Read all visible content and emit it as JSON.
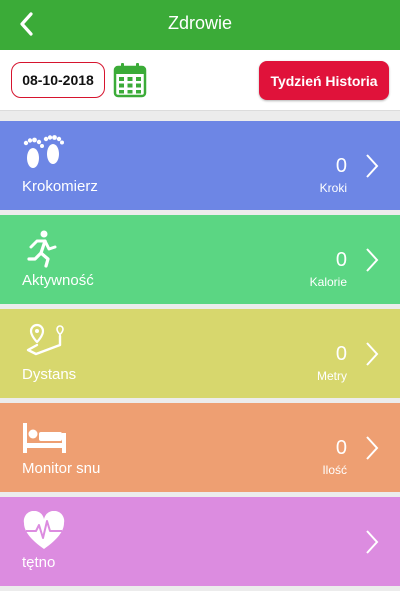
{
  "header": {
    "title": "Zdrowie"
  },
  "toolbar": {
    "date": "08-10-2018",
    "history_button": "Tydzień Historia"
  },
  "cards": [
    {
      "label": "Krokomierz",
      "value": "0",
      "unit": "Kroki",
      "color": "#6d86e5",
      "icon": "footprints-icon"
    },
    {
      "label": "Aktywność",
      "value": "0",
      "unit": "Kalorie",
      "color": "#5bd683",
      "icon": "running-person-icon"
    },
    {
      "label": "Dystans",
      "value": "0",
      "unit": "Metry",
      "color": "#d7d76d",
      "icon": "route-pin-icon"
    },
    {
      "label": "Monitor snu",
      "value": "0",
      "unit": "Ilość",
      "color": "#ee9f72",
      "icon": "bed-icon"
    },
    {
      "label": "tętno",
      "value": "",
      "unit": "",
      "color": "#dc8ce0",
      "icon": "heart-pulse-icon"
    }
  ],
  "colors": {
    "header_green": "#3bab38",
    "accent_red": "#e0123a",
    "calendar_green": "#3bab38"
  }
}
